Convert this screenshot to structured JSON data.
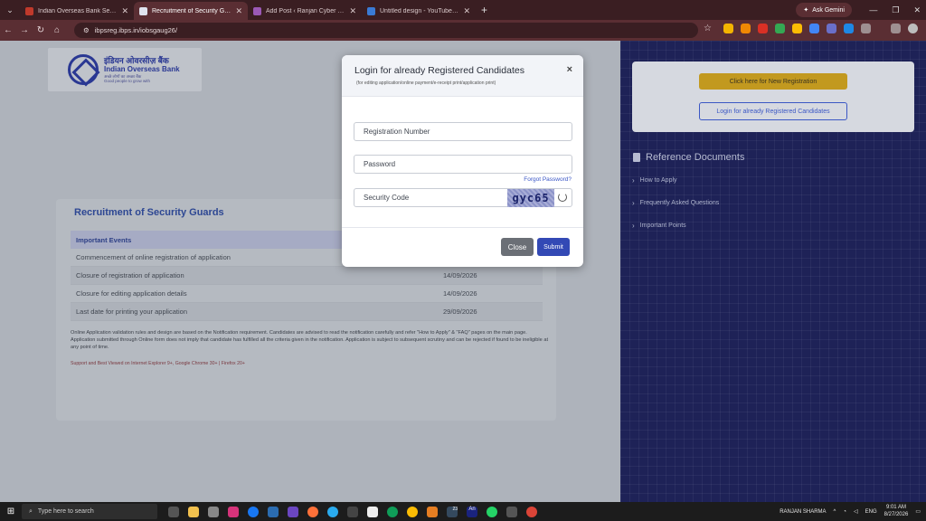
{
  "browser": {
    "tabs": [
      {
        "label": "Indian Overseas Bank Security",
        "color": "#c0392b",
        "active": false
      },
      {
        "label": "Recruitment of Security Guards",
        "color": "#dfe3ee",
        "active": true
      },
      {
        "label": "Add Post ‹ Ranjan Cyber Expert",
        "color": "#9b59b6",
        "active": false
      },
      {
        "label": "Untitled design - YouTube Thum",
        "color": "#3a7bd5",
        "active": false
      }
    ],
    "new_tab": "+",
    "ask_gemini": "Ask Gemini",
    "url": "ibpsreg.ibps.in/iobsgaug26/"
  },
  "bank": {
    "hindi_name": "इंडियन ओवरसीज़ बैंक",
    "english_name": "Indian Overseas Bank",
    "tagline_hindi": "अच्छे लोगों का अच्छा बैंक",
    "tagline": "Good people to grow with"
  },
  "recruitment": {
    "title": "Recruitment of Security Guards",
    "events_header": "Important Events",
    "events": [
      {
        "name": "Commencement of online registration of application",
        "date": ""
      },
      {
        "name": "Closure of registration of application",
        "date": "14/09/2026"
      },
      {
        "name": "Closure for editing application details",
        "date": "14/09/2026"
      },
      {
        "name": "Last date for printing your application",
        "date": "29/09/2026"
      }
    ],
    "note": "Online Application validation rules and design are based on the Notification requirement. Candidates are advised to read the notification carefully and refer \"How to Apply\" & \"FAQ\" pages on the main page. Application submitted through Online form does not imply that candidate has fulfilled all the criteria given in the notification. Application is subject to subsequent scrutiny and can be rejected if found to be ineligible at any point of time.",
    "support": "Support and Best Viewed on Internet Explorer 9+, Google Chrome 30+ | Firefox 20+"
  },
  "right_panel": {
    "new_registration": "Click here for New Registration",
    "login_registered": "Login for already Registered Candidates",
    "reference_title": "Reference Documents",
    "reference_items": [
      "How to Apply",
      "Frequently Asked Questions",
      "Important Points"
    ]
  },
  "modal": {
    "title": "Login for already Registered Candidates",
    "subtitle": "(for editing application/online payment/e-receipt print/application print)",
    "close_symbol": "×",
    "registration_placeholder": "Registration Number",
    "password_placeholder": "Password",
    "forgot_password": "Forgot Password?",
    "security_code_placeholder": "Security Code",
    "captcha": "gyc65",
    "close_button": "Close",
    "submit_button": "Submit"
  },
  "taskbar": {
    "search_placeholder": "Type here to search",
    "user": "RANJAN SHARMA",
    "language": "ENG",
    "time": "9:01 AM",
    "date": "8/27/2026",
    "badge": "23"
  }
}
